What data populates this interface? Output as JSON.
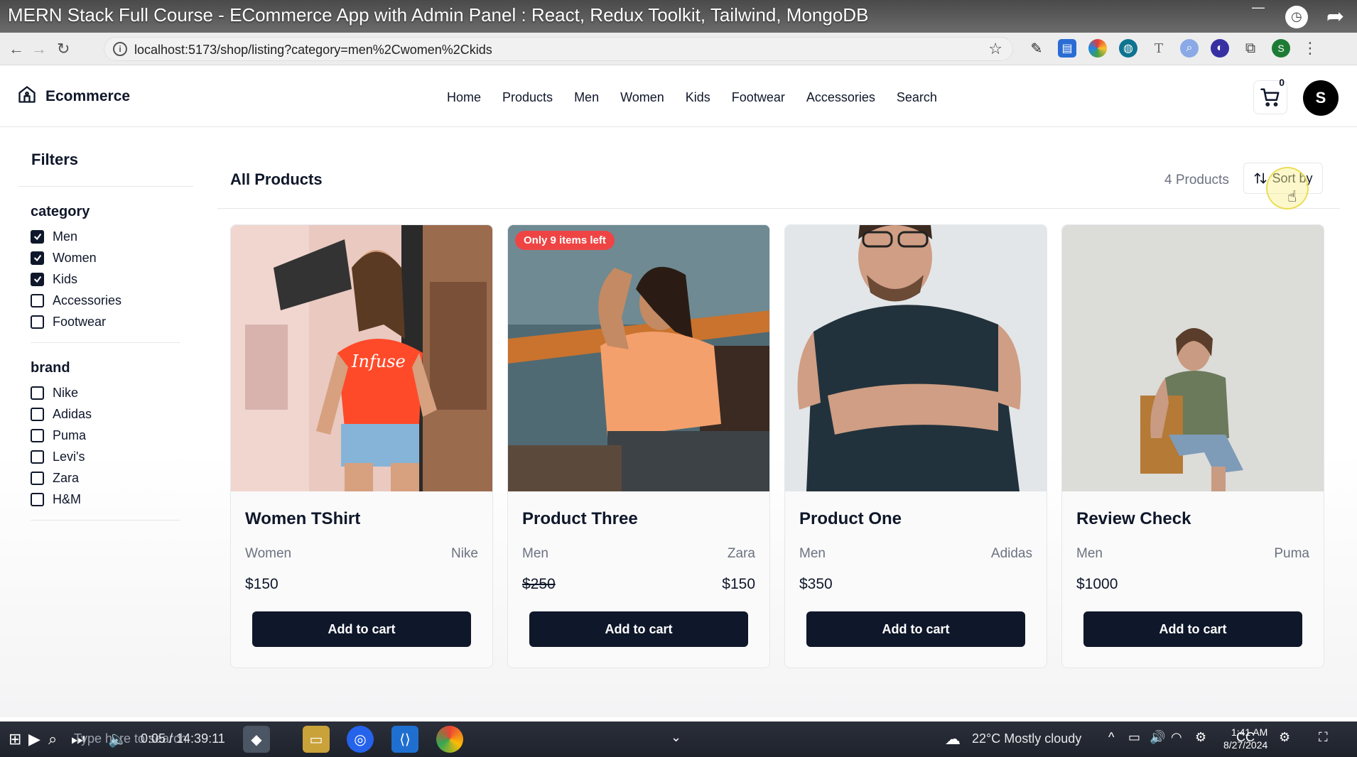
{
  "video": {
    "title": "MERN Stack Full Course - ECommerce App with Admin Panel : React, Redux Toolkit, Tailwind, MongoDB",
    "time": "0:05 / 14:39:11"
  },
  "browser": {
    "url": "localhost:5173/shop/listing?category=men%2Cwomen%2Ckids",
    "profile_initial": "S"
  },
  "header": {
    "brand": "Ecommerce",
    "nav": [
      "Home",
      "Products",
      "Men",
      "Women",
      "Kids",
      "Footwear",
      "Accessories",
      "Search"
    ],
    "cart_count": "0",
    "avatar_initial": "S"
  },
  "filters": {
    "title": "Filters",
    "groups": [
      {
        "title": "category",
        "options": [
          {
            "label": "Men",
            "checked": true
          },
          {
            "label": "Women",
            "checked": true
          },
          {
            "label": "Kids",
            "checked": true
          },
          {
            "label": "Accessories",
            "checked": false
          },
          {
            "label": "Footwear",
            "checked": false
          }
        ]
      },
      {
        "title": "brand",
        "options": [
          {
            "label": "Nike",
            "checked": false
          },
          {
            "label": "Adidas",
            "checked": false
          },
          {
            "label": "Puma",
            "checked": false
          },
          {
            "label": "Levi's",
            "checked": false
          },
          {
            "label": "Zara",
            "checked": false
          },
          {
            "label": "H&M",
            "checked": false
          }
        ]
      }
    ]
  },
  "listing": {
    "title": "All Products",
    "count": "4 Products",
    "sort_label": "Sort by",
    "add_to_cart": "Add to cart",
    "products": [
      {
        "name": "Women TShirt",
        "category": "Women",
        "brand": "Nike",
        "price": "$150",
        "sale_price": "",
        "badge": ""
      },
      {
        "name": "Product Three",
        "category": "Men",
        "brand": "Zara",
        "price": "$250",
        "sale_price": "$150",
        "badge": "Only 9 items left"
      },
      {
        "name": "Product One",
        "category": "Men",
        "brand": "Adidas",
        "price": "$350",
        "sale_price": "",
        "badge": ""
      },
      {
        "name": "Review Check",
        "category": "Men",
        "brand": "Puma",
        "price": "$1000",
        "sale_price": "",
        "badge": ""
      }
    ]
  },
  "taskbar": {
    "search_placeholder": "Type here to search",
    "weather": "22°C  Mostly cloudy",
    "time": "1:41 AM",
    "date": "8/27/2024"
  },
  "colors": {
    "primary": "#0f172a",
    "badge": "#ef4444",
    "muted": "#6b7280"
  }
}
